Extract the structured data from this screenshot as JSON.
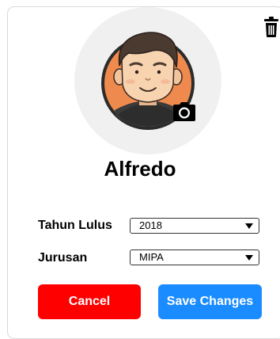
{
  "profile": {
    "name": "Alfredo"
  },
  "form": {
    "graduation_year": {
      "label": "Tahun Lulus",
      "value": "2018"
    },
    "major": {
      "label": "Jurusan",
      "value": "MIPA"
    }
  },
  "actions": {
    "cancel_label": "Cancel",
    "save_label": "Save Changes"
  },
  "icons": {
    "delete": "trash-icon",
    "change_photo": "camera-icon"
  },
  "colors": {
    "cancel": "#ff0000",
    "save": "#1a8cff",
    "avatar_background": "#f0f0f0"
  }
}
